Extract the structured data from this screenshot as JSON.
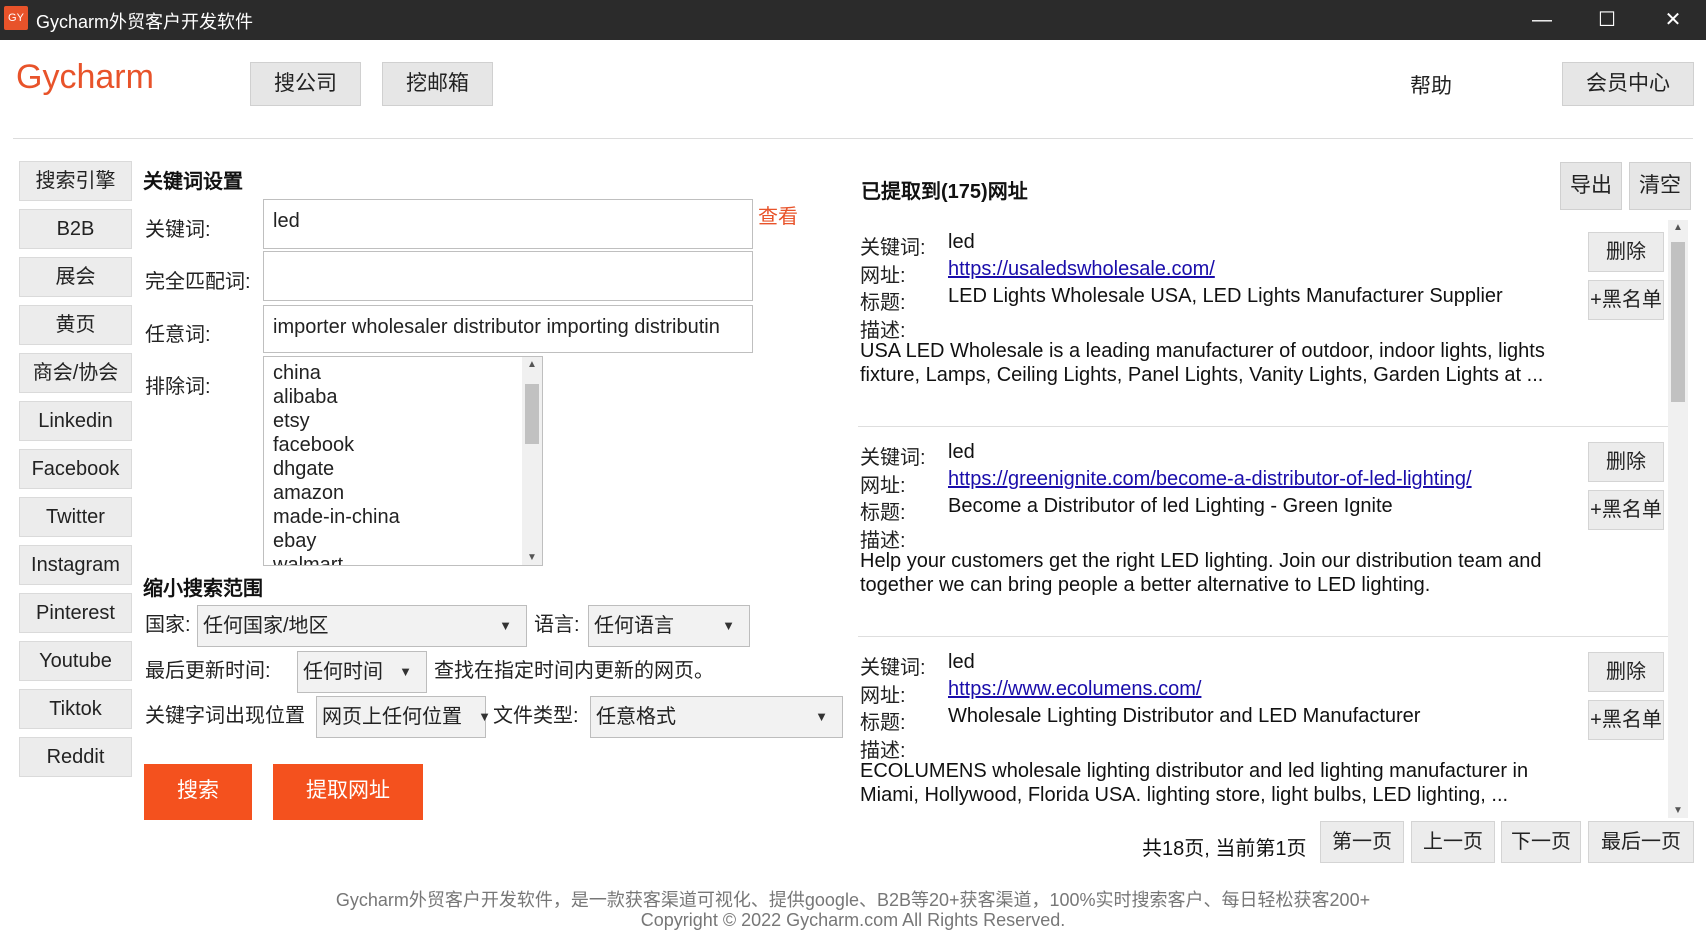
{
  "window": {
    "icon_text": "GY",
    "title": "Gycharm外贸客户开发软件",
    "controls": [
      "—",
      "☐",
      "✕"
    ]
  },
  "header": {
    "brand": "Gycharm",
    "nav": [
      "搜公司",
      "挖邮箱"
    ],
    "help": "帮助",
    "member": "会员中心"
  },
  "sidebar": {
    "items": [
      "搜索引擎",
      "B2B",
      "展会",
      "黄页",
      "商会/协会",
      "Linkedin",
      "Facebook",
      "Twitter",
      "Instagram",
      "Pinterest",
      "Youtube",
      "Tiktok",
      "Reddit"
    ]
  },
  "keywords": {
    "section_title": "关键词设置",
    "keyword_label": "关键词:",
    "keyword_value": "led",
    "view_link": "查看",
    "exact_label": "完全匹配词:",
    "exact_value": "",
    "any_label": "任意词:",
    "any_value": "importer wholesaler distributor importing distributin",
    "exclude_label": "排除词:",
    "exclude_items": [
      "china",
      "alibaba",
      "etsy",
      "facebook",
      "dhgate",
      "amazon",
      "made-in-china",
      "ebay",
      "walmart"
    ]
  },
  "narrow": {
    "section_title": "缩小搜索范围",
    "country_label": "国家:",
    "country_value": "任何国家/地区",
    "language_label": "语言:",
    "language_value": "任何语言",
    "updated_label": "最后更新时间:",
    "updated_value": "任何时间",
    "updated_hint": "查找在指定时间内更新的网页。",
    "position_label": "关键字词出现位置",
    "position_value": "网页上任何位置",
    "filetype_label": "文件类型:",
    "filetype_value": "任意格式"
  },
  "actions": {
    "search": "搜索",
    "extract": "提取网址"
  },
  "results": {
    "title": "已提取到(175)网址",
    "export": "导出",
    "clear": "清空",
    "labels": {
      "keyword": "关键词:",
      "url": "网址:",
      "title": "标题:",
      "desc": "描述:"
    },
    "delete_label": "删除",
    "blacklist_label": "+黑名单",
    "items": [
      {
        "keyword": "led",
        "url": "https://usaledswholesale.com/",
        "title": "LED Lights Wholesale USA, LED Lights Manufacturer Supplier",
        "description": "USA LED Wholesale is a leading manufacturer of outdoor, indoor lights, lights fixture, Lamps, Ceiling Lights, Panel Lights, Vanity Lights, Garden Lights at ..."
      },
      {
        "keyword": "led",
        "url": "https://greenignite.com/become-a-distributor-of-led-lighting/",
        "title": "Become a Distributor of led Lighting - Green Ignite",
        "description": "Help your customers get the right LED lighting. Join our distribution team and together we can bring people a better alternative to LED lighting."
      },
      {
        "keyword": "led",
        "url": "https://www.ecolumens.com/",
        "title": "Wholesale Lighting Distributor and LED Manufacturer",
        "description": "ECOLUMENS wholesale lighting distributor and led lighting manufacturer in Miami, Hollywood, Florida USA. lighting store, light bulbs, LED lighting, ..."
      }
    ]
  },
  "pager": {
    "info": "共18页, 当前第1页",
    "first": "第一页",
    "prev": "上一页",
    "next": "下一页",
    "last": "最后一页"
  },
  "footer": {
    "line1": "Gycharm外贸客户开发软件，是一款获客渠道可视化、提供google、B2B等20+获客渠道，100%实时搜索客户、每日轻松获客200+",
    "line2": "Copyright © 2022 Gycharm.com All Rights Reserved."
  }
}
